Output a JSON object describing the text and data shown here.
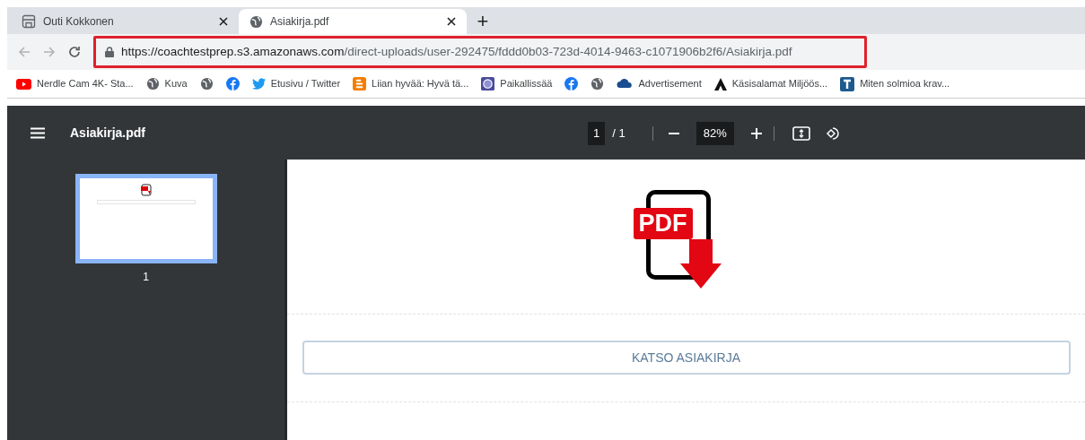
{
  "tabs": [
    {
      "title": "Outi Kokkonen",
      "kind": "store",
      "selected": false
    },
    {
      "title": "Asiakirja.pdf",
      "kind": "globe",
      "selected": true
    }
  ],
  "new_tab": "+",
  "address_bar": {
    "url_host": "https://coachtestprep.s3.amazonaws.com",
    "url_path": "/direct-uploads/user-292475/fddd0b03-723d-4014-9463-c1071906b2f6/Asiakirja.pdf",
    "highlighted": true
  },
  "bookmarks": [
    {
      "kind": "youtube",
      "label": "Nerdle Cam 4K- Sta..."
    },
    {
      "kind": "globe",
      "label": "Kuva"
    },
    {
      "kind": "globe"
    },
    {
      "kind": "facebook"
    },
    {
      "kind": "twitter",
      "label": "Etusivu / Twitter"
    },
    {
      "kind": "blogger",
      "label": "Liian hyvää: Hyvä tä..."
    },
    {
      "kind": "badge",
      "label": "Paikallissää"
    },
    {
      "kind": "facebook"
    },
    {
      "kind": "globe"
    },
    {
      "kind": "cloud",
      "label": "Advertisement"
    },
    {
      "kind": "triangle",
      "label": "Käsisalamat Miljöös..."
    },
    {
      "kind": "tile",
      "label": "Miten solmioa krav..."
    }
  ],
  "viewer": {
    "title": "Asiakirja.pdf",
    "page": "1",
    "page_total": "/ 1",
    "zoom": "82%"
  },
  "thumbnails": [
    {
      "number": "1",
      "selected": true
    }
  ],
  "document": {
    "icon_label": "PDF",
    "button": "KATSO ASIAKIRJA"
  }
}
